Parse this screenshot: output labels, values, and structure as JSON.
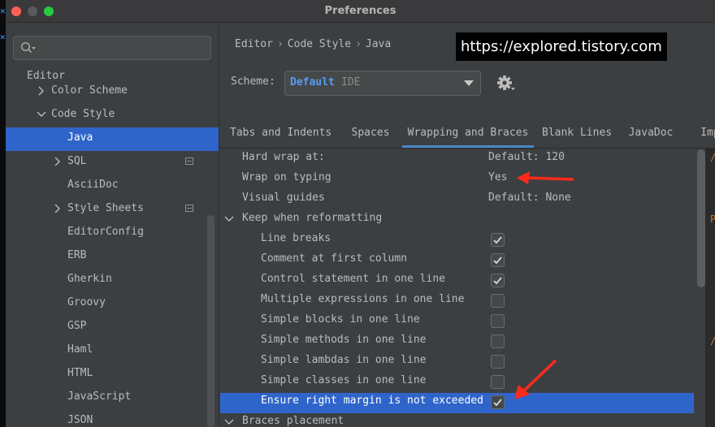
{
  "window": {
    "title": "Preferences"
  },
  "search": {
    "placeholder": ""
  },
  "sidebar": {
    "items": [
      {
        "label": "Editor",
        "type": "section"
      },
      {
        "label": "Color Scheme",
        "type": "collapsed"
      },
      {
        "label": "Code Style",
        "type": "expanded"
      },
      {
        "label": "Java",
        "type": "leaf",
        "selected": true
      },
      {
        "label": "SQL",
        "type": "collapsed",
        "has_option_icon": true
      },
      {
        "label": "AsciiDoc",
        "type": "leaf"
      },
      {
        "label": "Style Sheets",
        "type": "collapsed",
        "has_option_icon": true
      },
      {
        "label": "EditorConfig",
        "type": "leaf"
      },
      {
        "label": "ERB",
        "type": "leaf"
      },
      {
        "label": "Gherkin",
        "type": "leaf"
      },
      {
        "label": "Groovy",
        "type": "leaf"
      },
      {
        "label": "GSP",
        "type": "leaf"
      },
      {
        "label": "Haml",
        "type": "leaf"
      },
      {
        "label": "HTML",
        "type": "leaf"
      },
      {
        "label": "JavaScript",
        "type": "leaf"
      },
      {
        "label": "JSON",
        "type": "leaf"
      }
    ]
  },
  "breadcrumb": {
    "items": [
      "Editor",
      "Code Style",
      "Java"
    ],
    "separator": "›"
  },
  "watermark": {
    "text": "https://explored.tistory.com"
  },
  "scheme": {
    "label": "Scheme:",
    "name": "Default",
    "type": "IDE"
  },
  "tabs": [
    {
      "label": "Tabs and Indents",
      "active": false
    },
    {
      "label": "Spaces",
      "active": false
    },
    {
      "label": "Wrapping and Braces",
      "active": true
    },
    {
      "label": "Blank Lines",
      "active": false
    },
    {
      "label": "JavaDoc",
      "active": false
    },
    {
      "label": "Imp",
      "active": false
    }
  ],
  "settings": {
    "rows": [
      {
        "label": "Hard wrap at:",
        "value": "Default: 120",
        "kind": "value"
      },
      {
        "label": "Wrap on typing",
        "value": "Yes",
        "kind": "value"
      },
      {
        "label": "Visual guides",
        "value": "Default: None",
        "kind": "value"
      },
      {
        "label": "Keep when reformatting",
        "kind": "group"
      },
      {
        "label": "Line breaks",
        "kind": "checkbox",
        "checked": true
      },
      {
        "label": "Comment at first column",
        "kind": "checkbox",
        "checked": true
      },
      {
        "label": "Control statement in one line",
        "kind": "checkbox",
        "checked": true
      },
      {
        "label": "Multiple expressions in one line",
        "kind": "checkbox",
        "checked": false
      },
      {
        "label": "Simple blocks in one line",
        "kind": "checkbox",
        "checked": false
      },
      {
        "label": "Simple methods in one line",
        "kind": "checkbox",
        "checked": false
      },
      {
        "label": "Simple lambdas in one line",
        "kind": "checkbox",
        "checked": false
      },
      {
        "label": "Simple classes in one line",
        "kind": "checkbox",
        "checked": false
      },
      {
        "label": "Ensure right margin is not exceeded",
        "kind": "checkbox",
        "checked": true,
        "selected": true
      },
      {
        "label": "Braces placement",
        "kind": "group"
      }
    ]
  },
  "colors": {
    "accent": "#2f65ca",
    "tab_underline": "#4a88c7",
    "scheme_name": "#589df6",
    "annotation_arrow": "#ff2a1a"
  }
}
